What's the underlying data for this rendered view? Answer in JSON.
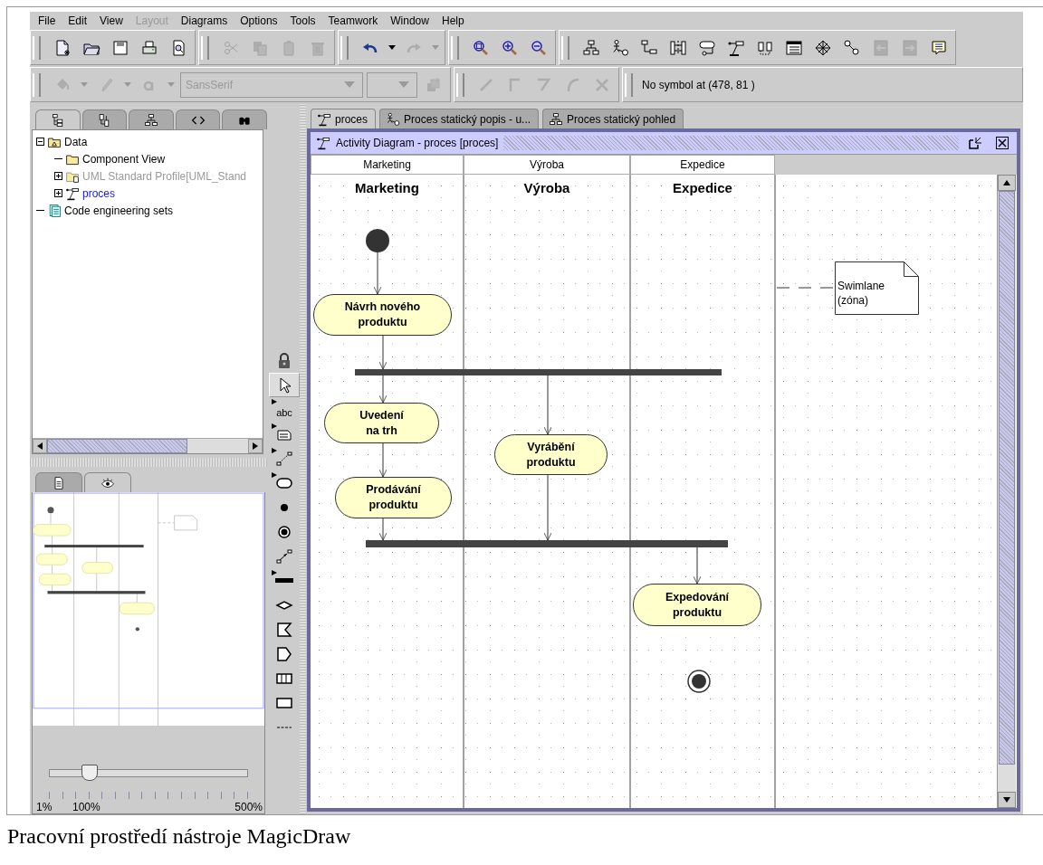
{
  "menu": [
    {
      "label": "File",
      "disabled": false
    },
    {
      "label": "Edit",
      "disabled": false
    },
    {
      "label": "View",
      "disabled": false
    },
    {
      "label": "Layout",
      "disabled": true
    },
    {
      "label": "Diagrams",
      "disabled": false
    },
    {
      "label": "Options",
      "disabled": false
    },
    {
      "label": "Tools",
      "disabled": false
    },
    {
      "label": "Teamwork",
      "disabled": false
    },
    {
      "label": "Window",
      "disabled": false
    },
    {
      "label": "Help",
      "disabled": false
    }
  ],
  "toolbar_rows": [
    {
      "groups": [
        {
          "items": [
            {
              "kind": "new",
              "disabled": false
            },
            {
              "kind": "open",
              "disabled": false
            },
            {
              "kind": "save",
              "disabled": false
            },
            {
              "kind": "print",
              "disabled": false
            },
            {
              "kind": "preview",
              "disabled": false
            }
          ]
        },
        {
          "items": [
            {
              "kind": "cut",
              "disabled": true
            },
            {
              "kind": "copy",
              "disabled": true
            },
            {
              "kind": "paste",
              "disabled": true
            },
            {
              "kind": "delete",
              "disabled": true
            }
          ]
        },
        {
          "items": [
            {
              "kind": "undo",
              "disabled": false,
              "dropdown": true
            },
            {
              "kind": "redo",
              "disabled": true,
              "dropdown": true
            }
          ]
        },
        {
          "items": [
            {
              "kind": "zoom-fit",
              "disabled": false
            },
            {
              "kind": "zoom-in",
              "disabled": false
            },
            {
              "kind": "zoom-out",
              "disabled": false
            }
          ]
        },
        {
          "items": [
            {
              "kind": "hierarchy",
              "disabled": false
            },
            {
              "kind": "actor-link",
              "disabled": false
            },
            {
              "kind": "tree-link",
              "disabled": false
            },
            {
              "kind": "sequence",
              "disabled": false
            },
            {
              "kind": "state-box",
              "disabled": false
            },
            {
              "kind": "activity",
              "disabled": false
            },
            {
              "kind": "component-pair",
              "disabled": false
            },
            {
              "kind": "table",
              "disabled": false
            },
            {
              "kind": "web",
              "disabled": false
            },
            {
              "kind": "node-link",
              "disabled": false
            },
            {
              "kind": "back",
              "disabled": true
            },
            {
              "kind": "forward",
              "disabled": true
            },
            {
              "kind": "note",
              "disabled": false
            }
          ]
        }
      ]
    },
    {
      "groups": [
        {
          "items": [
            {
              "kind": "fill",
              "disabled": true,
              "dropdown": true
            },
            {
              "kind": "pen",
              "disabled": true,
              "dropdown": true
            },
            {
              "kind": "font-color",
              "disabled": true,
              "dropdown": true
            },
            {
              "kind": "combo",
              "disabled": true,
              "value": "SansSerif"
            },
            {
              "kind": "combo-small",
              "disabled": true
            },
            {
              "kind": "arrange",
              "disabled": true
            }
          ]
        },
        {
          "items": [
            {
              "kind": "line-straight",
              "disabled": true
            },
            {
              "kind": "line-rect",
              "disabled": true
            },
            {
              "kind": "line-bent",
              "disabled": true
            },
            {
              "kind": "line-curve",
              "disabled": true
            },
            {
              "kind": "line-reset",
              "disabled": true
            }
          ]
        },
        {
          "items": [
            {
              "kind": "status",
              "text": "No symbol at (478, 81 )"
            }
          ]
        }
      ]
    }
  ],
  "browser_tabs": [
    {
      "kind": "containment",
      "selected": true
    },
    {
      "kind": "inheritance",
      "selected": false
    },
    {
      "kind": "hierarchy",
      "selected": false
    },
    {
      "kind": "code",
      "selected": false
    },
    {
      "kind": "search",
      "selected": false
    }
  ],
  "tree": [
    {
      "label": "Data",
      "kind": "package",
      "expanded": true,
      "dimmed": false,
      "highlighted": false,
      "children": [
        {
          "label": "Component View",
          "kind": "folder",
          "dimmed": false,
          "highlighted": false
        },
        {
          "label": "UML Standard Profile[UML_Stand",
          "kind": "profile",
          "expanded": false,
          "dimmed": true,
          "highlighted": false
        },
        {
          "label": "proces",
          "kind": "activity",
          "expanded": false,
          "dimmed": false,
          "highlighted": true
        }
      ]
    },
    {
      "label": "Code engineering sets",
      "kind": "code-set",
      "dimmed": false,
      "highlighted": false
    }
  ],
  "overview": {
    "tabs": [
      {
        "kind": "document",
        "selected": false
      },
      {
        "kind": "eye",
        "selected": true
      }
    ],
    "zoom": {
      "level": 0.2,
      "labels": [
        "1%",
        "100%",
        "500%"
      ]
    }
  },
  "palette": [
    {
      "kind": "lock",
      "selected": false
    },
    {
      "kind": "pointer",
      "selected": true
    },
    {
      "kind": "text",
      "label": "abc",
      "more": true,
      "selected": false
    },
    {
      "kind": "note",
      "more": true,
      "selected": false
    },
    {
      "kind": "anchor",
      "more": true,
      "selected": false
    },
    {
      "kind": "action",
      "more": true,
      "selected": false
    },
    {
      "kind": "initial",
      "selected": false
    },
    {
      "kind": "final",
      "selected": false
    },
    {
      "kind": "transition",
      "selected": false
    },
    {
      "kind": "bar",
      "more": true,
      "selected": false
    },
    {
      "kind": "decision",
      "selected": false
    },
    {
      "kind": "receive",
      "selected": false
    },
    {
      "kind": "send",
      "selected": false
    },
    {
      "kind": "swimlane",
      "selected": false
    },
    {
      "kind": "rectangle",
      "selected": false
    },
    {
      "kind": "separator",
      "selected": false
    }
  ],
  "diagram_tabs": [
    {
      "label": "proces",
      "kind": "activity",
      "selected": true
    },
    {
      "label": "Proces statický popis - u...",
      "kind": "actor-link",
      "selected": false
    },
    {
      "label": "Proces statický pohled",
      "kind": "hierarchy",
      "selected": false
    }
  ],
  "diagram": {
    "title": "Activity Diagram - proces [proces]",
    "swimlanes": [
      {
        "header": "Marketing",
        "title": "Marketing"
      },
      {
        "header": "Výroba",
        "title": "Výroba"
      },
      {
        "header": "Expedice",
        "title": "Expedice"
      }
    ],
    "nodes": [
      {
        "kind": "initial"
      },
      {
        "kind": "action",
        "label": "Návrh nového\nproduktu"
      },
      {
        "kind": "bar"
      },
      {
        "kind": "action",
        "label": "Uvedení\nna trh"
      },
      {
        "kind": "action",
        "label": "Vyrábění\nproduktu"
      },
      {
        "kind": "action",
        "label": "Prodávání\nproduktu"
      },
      {
        "kind": "bar"
      },
      {
        "kind": "action",
        "label": "Expedování\nproduktu"
      },
      {
        "kind": "final"
      }
    ],
    "note": {
      "text": "Swimlane\n(zóna)"
    }
  },
  "caption": "Pracovní prostředí nástroje MagicDraw"
}
